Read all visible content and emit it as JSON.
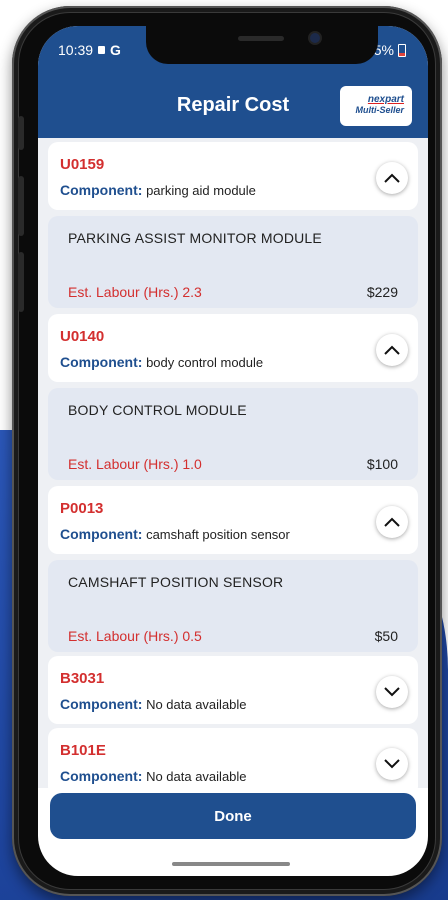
{
  "status": {
    "time": "10:39",
    "carrier_glyph": "G",
    "network": "G",
    "battery": "15%"
  },
  "header": {
    "title": "Repair Cost",
    "logo_top": "nexpart",
    "logo_bottom": "Multi-Seller"
  },
  "component_label": "Component:",
  "items": [
    {
      "code": "U0159",
      "component": "parking aid module",
      "expanded": true,
      "part": "PARKING ASSIST MONITOR MODULE",
      "labour": "Est. Labour (Hrs.) 2.3",
      "price": "$229"
    },
    {
      "code": "U0140",
      "component": "body control module",
      "expanded": true,
      "part": "BODY CONTROL MODULE",
      "labour": "Est. Labour (Hrs.) 1.0",
      "price": "$100"
    },
    {
      "code": "P0013",
      "component": "camshaft position sensor",
      "expanded": true,
      "part": "CAMSHAFT POSITION SENSOR",
      "labour": "Est. Labour (Hrs.) 0.5",
      "price": "$50"
    },
    {
      "code": "B3031",
      "component": "No data available",
      "expanded": false
    },
    {
      "code": "B101E",
      "component": "No data available",
      "expanded": false
    }
  ],
  "footer": {
    "done_label": "Done"
  },
  "colors": {
    "brand": "#1f4f8f",
    "code_red": "#d32f2f",
    "detail_bg": "#e3e8f2"
  }
}
